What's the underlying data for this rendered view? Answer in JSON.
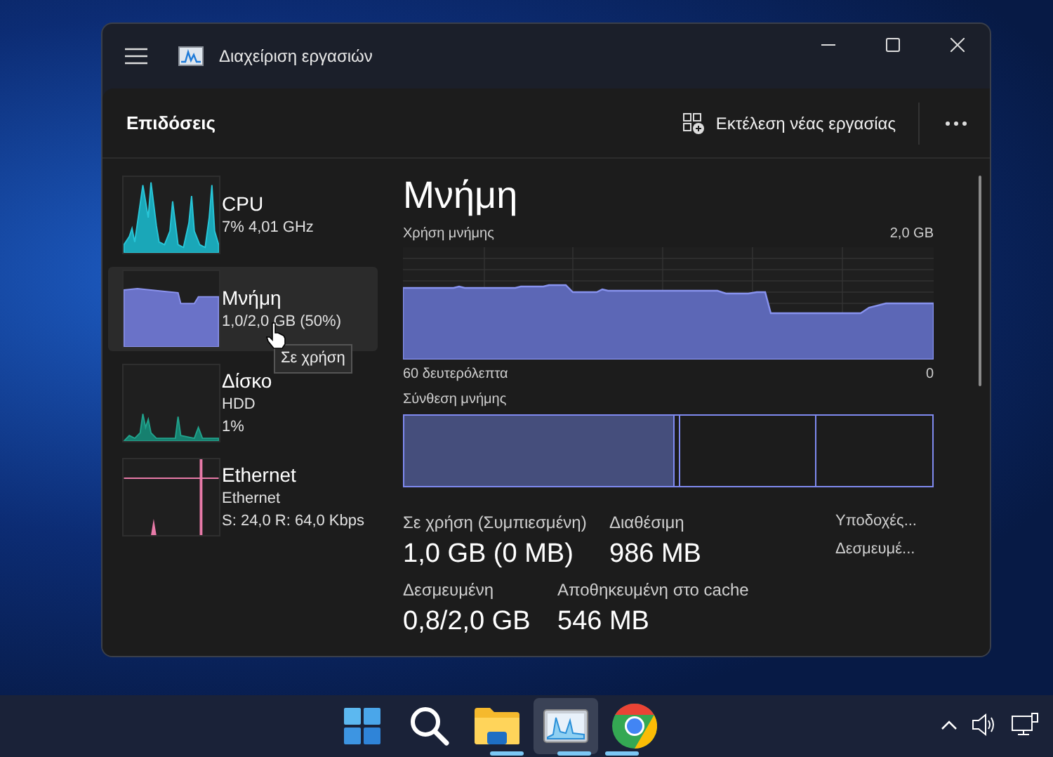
{
  "window": {
    "title": "Διαχείριση εργασιών"
  },
  "toolbar": {
    "title": "Επιδόσεις",
    "run_task": "Εκτέλεση νέας εργασίας"
  },
  "sidebar": {
    "items": [
      {
        "kind": "cpu",
        "name": "CPU",
        "details": [
          "7% 4,01 GHz"
        ],
        "selected": false
      },
      {
        "kind": "memory",
        "name": "Μνήμη",
        "details": [
          "1,0/2,0 GB (50%)"
        ],
        "selected": true
      },
      {
        "kind": "disk",
        "name": "Δίσκο",
        "details": [
          "HDD",
          "1%"
        ],
        "selected": false
      },
      {
        "kind": "network",
        "name": "Ethernet",
        "details": [
          "Ethernet",
          "S: 24,0 R: 64,0 Kbps"
        ],
        "selected": false
      }
    ]
  },
  "tooltip": "Σε χρήση",
  "main": {
    "title": "Μνήμη",
    "usage_label": "Χρήση μνήμης",
    "usage_max": "2,0 GB",
    "time_label": "60 δευτερόλεπτα",
    "time_end": "0",
    "composition_label": "Σύνθεση μνήμης",
    "stats": [
      {
        "label": "Σε χρήση (Συμπιεσμένη)",
        "value": "1,0 GB (0 MB)"
      },
      {
        "label": "Διαθέσιμη",
        "value": "986 MB"
      },
      {
        "label": "Δεσμευμένη",
        "value": "0,8/2,0 GB"
      },
      {
        "label": "Αποθηκευμένη στο cache",
        "value": "546 MB"
      }
    ],
    "side_stats": [
      "Υποδοχές...",
      "Δεσμευμέ..."
    ]
  }
}
